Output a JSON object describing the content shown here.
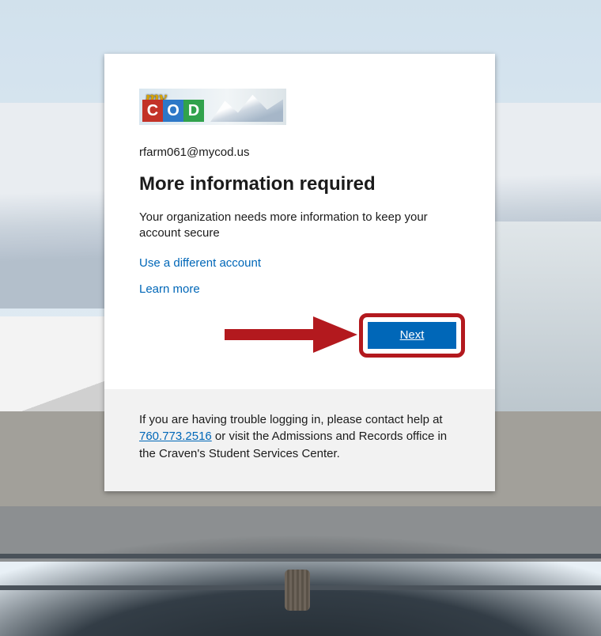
{
  "logo": {
    "script_text": "my",
    "tiles": [
      "C",
      "O",
      "D"
    ]
  },
  "identity": "rfarm061@mycod.us",
  "title": "More information required",
  "description": "Your organization needs more information to keep your account secure",
  "links": {
    "different_account": "Use a different account",
    "learn_more": "Learn more"
  },
  "buttons": {
    "next": "Next"
  },
  "footer": {
    "before_phone": "If you are having trouble logging in, please contact help at ",
    "phone": "760.773.2516",
    "after_phone": " or visit the Admissions and Records office in the Craven's Student Services Center."
  },
  "annotation": {
    "arrow_color": "#b3191e"
  }
}
